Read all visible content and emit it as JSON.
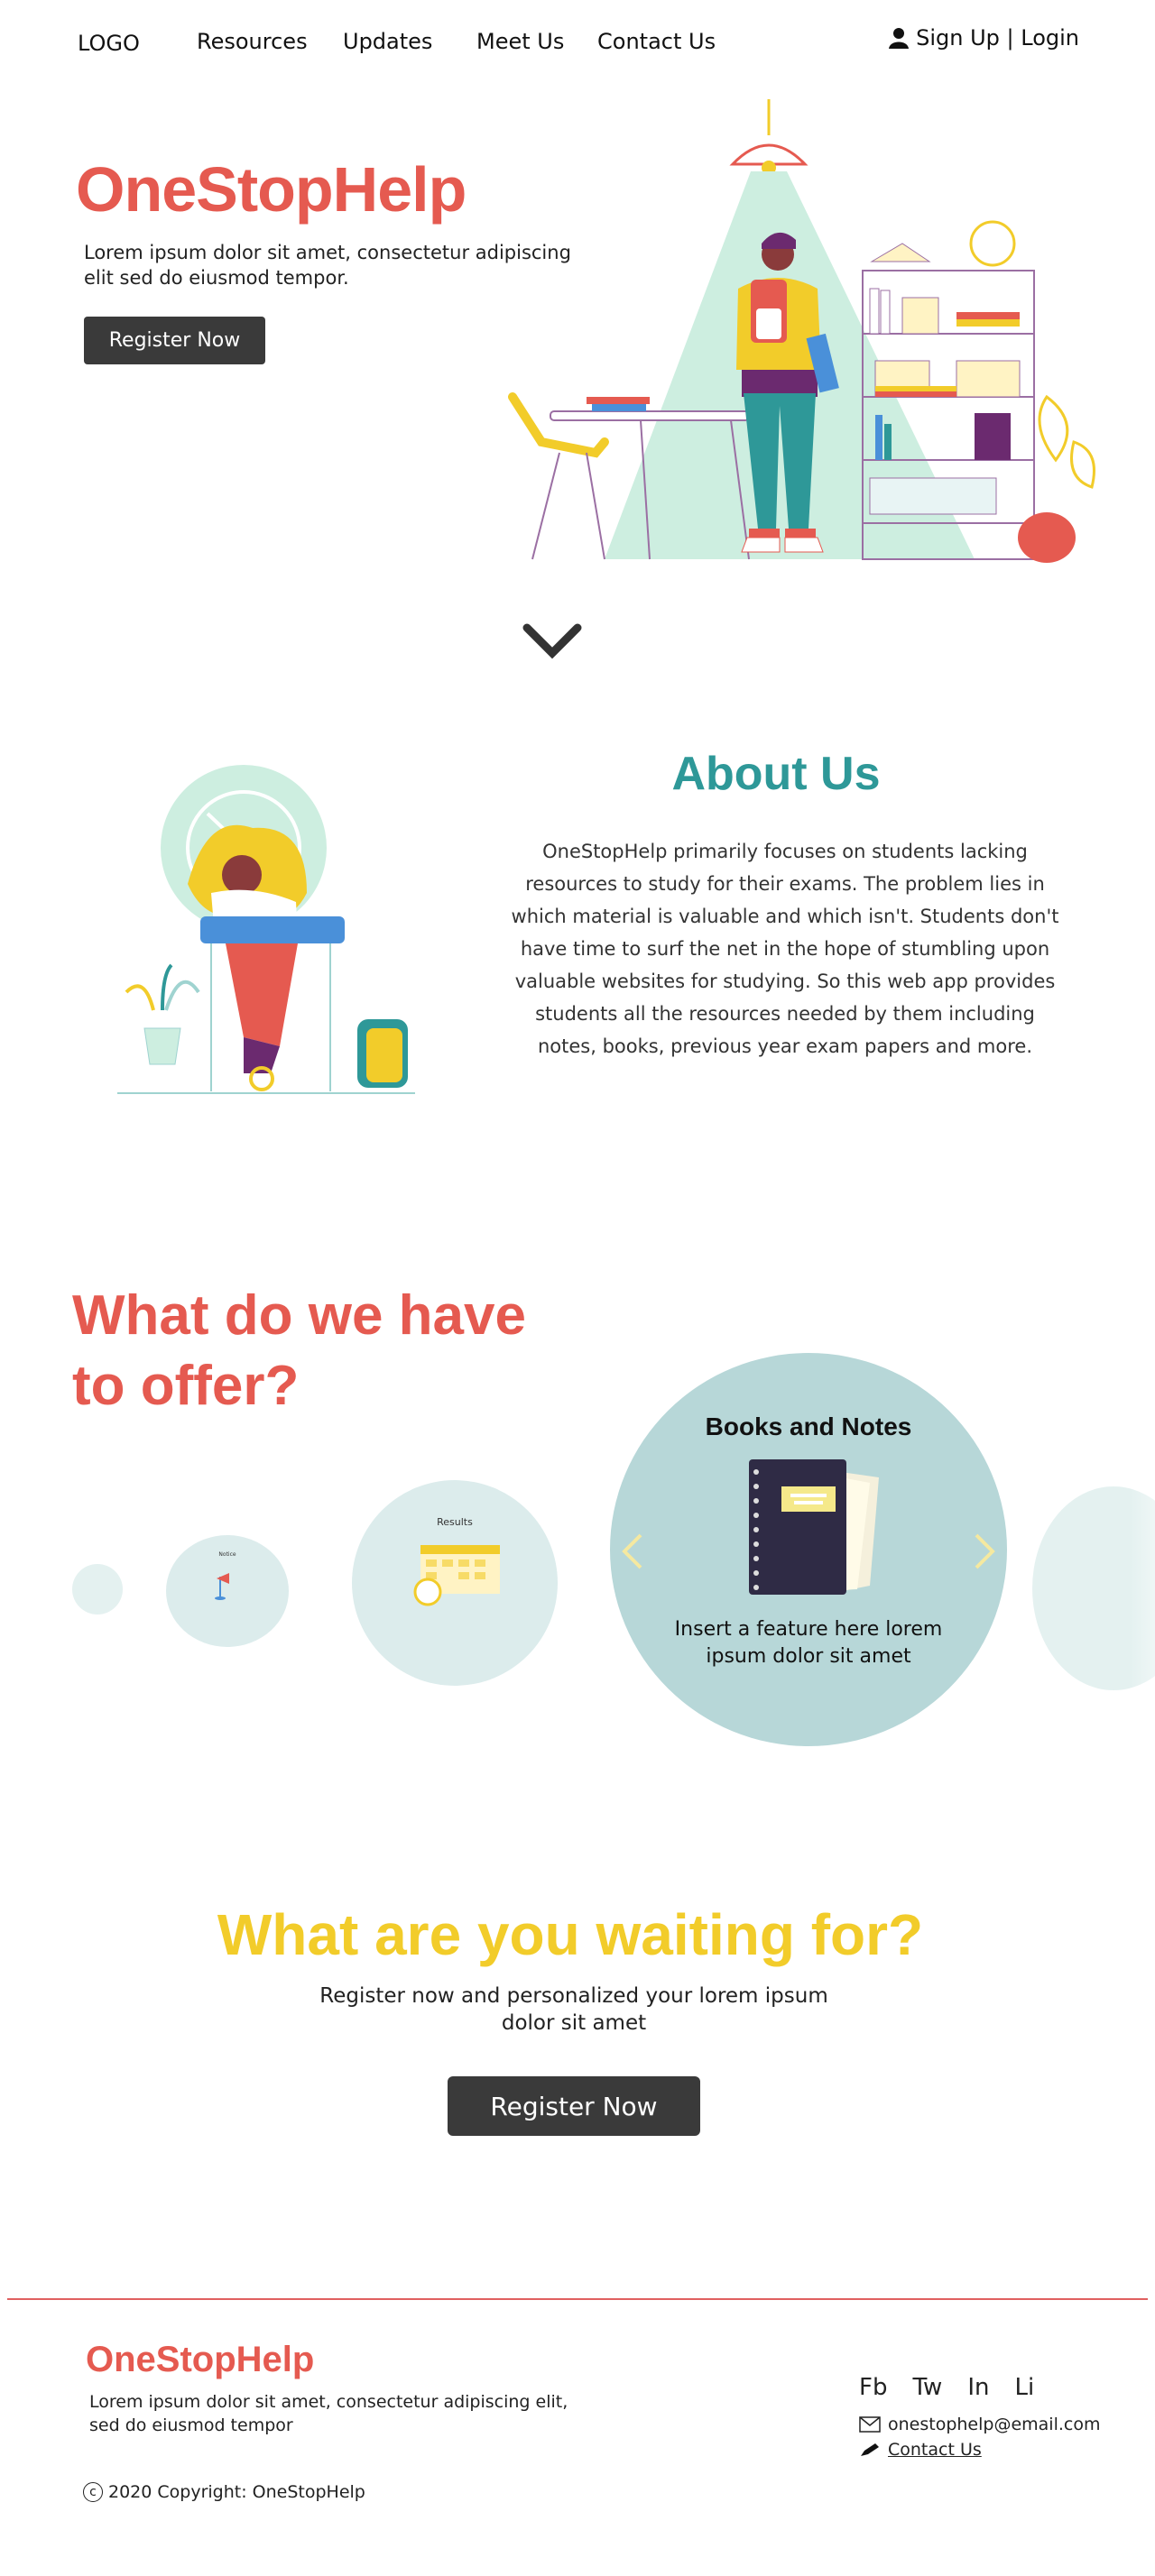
{
  "nav": {
    "logo": "LOGO",
    "links": [
      "Resources",
      "Updates",
      "Meet Us",
      "Contact Us"
    ],
    "auth": "Sign Up | Login",
    "auth_icon": "user-icon"
  },
  "hero": {
    "title": "OneStopHelp",
    "subtitle": "Lorem ipsum dolor sit amet, consectetur adipiscing elit sed do eiusmod tempor.",
    "button": "Register Now"
  },
  "about": {
    "title": "About Us",
    "text": "OneStopHelp primarily focuses on students lacking resources to study for their exams. The problem lies in which material is valuable and which isn't. Students don't have time to surf the net in the hope of stumbling upon valuable websites for studying. So this web app provides students all the resources needed by them including notes, books, previous year exam papers and more."
  },
  "offer": {
    "title": "What do we have to offer?",
    "carousel": {
      "tiny_label": "Notice",
      "results_label": "Results",
      "active_title": "Books and Notes",
      "active_desc": "Insert a feature here lorem ipsum dolor sit amet"
    }
  },
  "cta": {
    "title": "What are you waiting for?",
    "subtitle": "Register now and personalized your lorem ipsum dolor sit amet",
    "button": "Register Now"
  },
  "footer": {
    "brand": "OneStopHelp",
    "subtitle": "Lorem ipsum dolor sit amet, consectetur adipiscing elit, sed do eiusmod tempor",
    "copyright": "2020 Copyright: OneStopHelp",
    "copyright_symbol": "c",
    "social": [
      "Fb",
      "Tw",
      "In",
      "Li"
    ],
    "email": "onestophelp@email.com",
    "contact_link": "Contact Us"
  },
  "colors": {
    "brand_red": "#e55a50",
    "teal": "#2e9898",
    "yellow": "#f2cc2a",
    "dark_button": "#3a3a3a"
  }
}
